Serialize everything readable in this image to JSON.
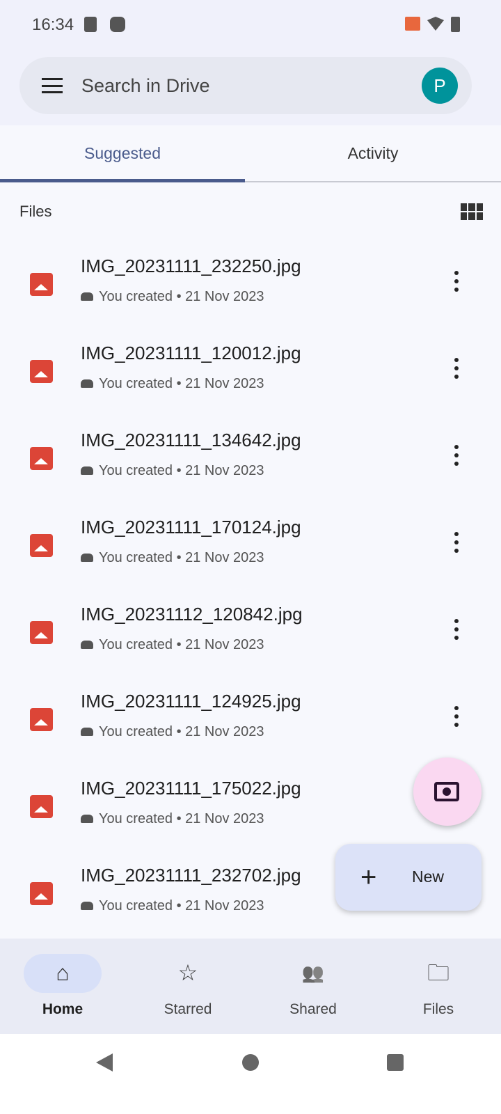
{
  "status_bar": {
    "time": "16:34"
  },
  "search": {
    "placeholder": "Search in Drive",
    "avatar_letter": "P"
  },
  "tabs": [
    {
      "label": "Suggested",
      "active": true
    },
    {
      "label": "Activity",
      "active": false
    }
  ],
  "section": {
    "label": "Files",
    "view_icon": "grid-view-icon"
  },
  "files": [
    {
      "name": "IMG_20231111_232250.jpg",
      "meta": "You created • 21 Nov 2023"
    },
    {
      "name": "IMG_20231111_120012.jpg",
      "meta": "You created • 21 Nov 2023"
    },
    {
      "name": "IMG_20231111_134642.jpg",
      "meta": "You created • 21 Nov 2023"
    },
    {
      "name": "IMG_20231111_170124.jpg",
      "meta": "You created • 21 Nov 2023"
    },
    {
      "name": "IMG_20231112_120842.jpg",
      "meta": "You created • 21 Nov 2023"
    },
    {
      "name": "IMG_20231111_124925.jpg",
      "meta": "You created • 21 Nov 2023"
    },
    {
      "name": "IMG_20231111_175022.jpg",
      "meta": "You created • 21 Nov 2023"
    },
    {
      "name": "IMG_20231111_232702.jpg",
      "meta": "You created • 21 Nov 2023"
    }
  ],
  "fab": {
    "camera_icon": "camera-icon",
    "new_label": "New"
  },
  "bottom_nav": [
    {
      "label": "Home",
      "icon": "⌂",
      "active": true
    },
    {
      "label": "Starred",
      "icon": "☆"
    },
    {
      "label": "Shared",
      "icon": "👥"
    },
    {
      "label": "Files",
      "icon": "🗀"
    }
  ],
  "colors": {
    "accent": "#4a5b8c",
    "file_icon": "#dc4537",
    "avatar": "#00939b"
  }
}
